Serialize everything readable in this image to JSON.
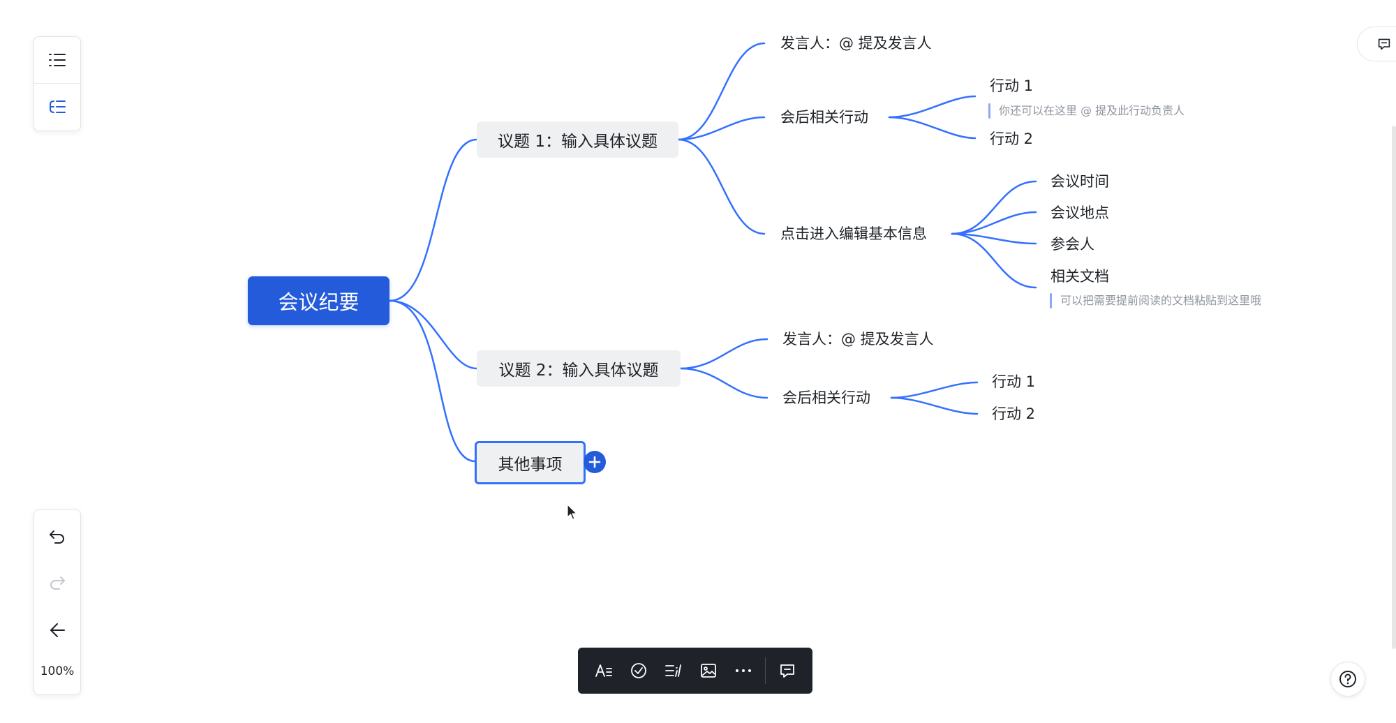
{
  "left_panel": {
    "outline_icon": "list-icon",
    "structure_icon": "mindmap-structure-icon"
  },
  "history_panel": {
    "undo_icon": "undo-icon",
    "redo_icon": "redo-icon",
    "layout_icon": "collapse-layout-icon",
    "zoom": "100%"
  },
  "mindmap": {
    "root": "会议纪要",
    "topic1": {
      "label": "议题 1：输入具体议题",
      "speaker": "发言人：@ 提及发言人",
      "actions_label": "会后相关行动",
      "action1": "行动 1",
      "action_note": "你还可以在这里 @ 提及此行动负责人",
      "action2": "行动 2",
      "info_label": "点击进入编辑基本信息",
      "info_items": [
        "会议时间",
        "会议地点",
        "参会人",
        "相关文档"
      ],
      "doc_note": "可以把需要提前阅读的文档粘贴到这里哦"
    },
    "topic2": {
      "label": "议题 2：输入具体议题",
      "speaker": "发言人：@ 提及发言人",
      "actions_label": "会后相关行动",
      "action1": "行动 1",
      "action2": "行动 2"
    },
    "topic3": {
      "label": "其他事项",
      "add_icon": "plus-icon"
    }
  },
  "bottom_toolbar": {
    "icons": [
      "text-style-icon",
      "check-circle-icon",
      "note-icon",
      "image-icon",
      "more-icon",
      "comment-icon"
    ]
  },
  "right_tab_icon": "comment-icon",
  "help_icon": "help-icon",
  "colors": {
    "accent": "#245bdb",
    "branch_line": "#3370ff",
    "topic_bg": "#eff0f1",
    "toolbar_bg": "#1f2329"
  }
}
